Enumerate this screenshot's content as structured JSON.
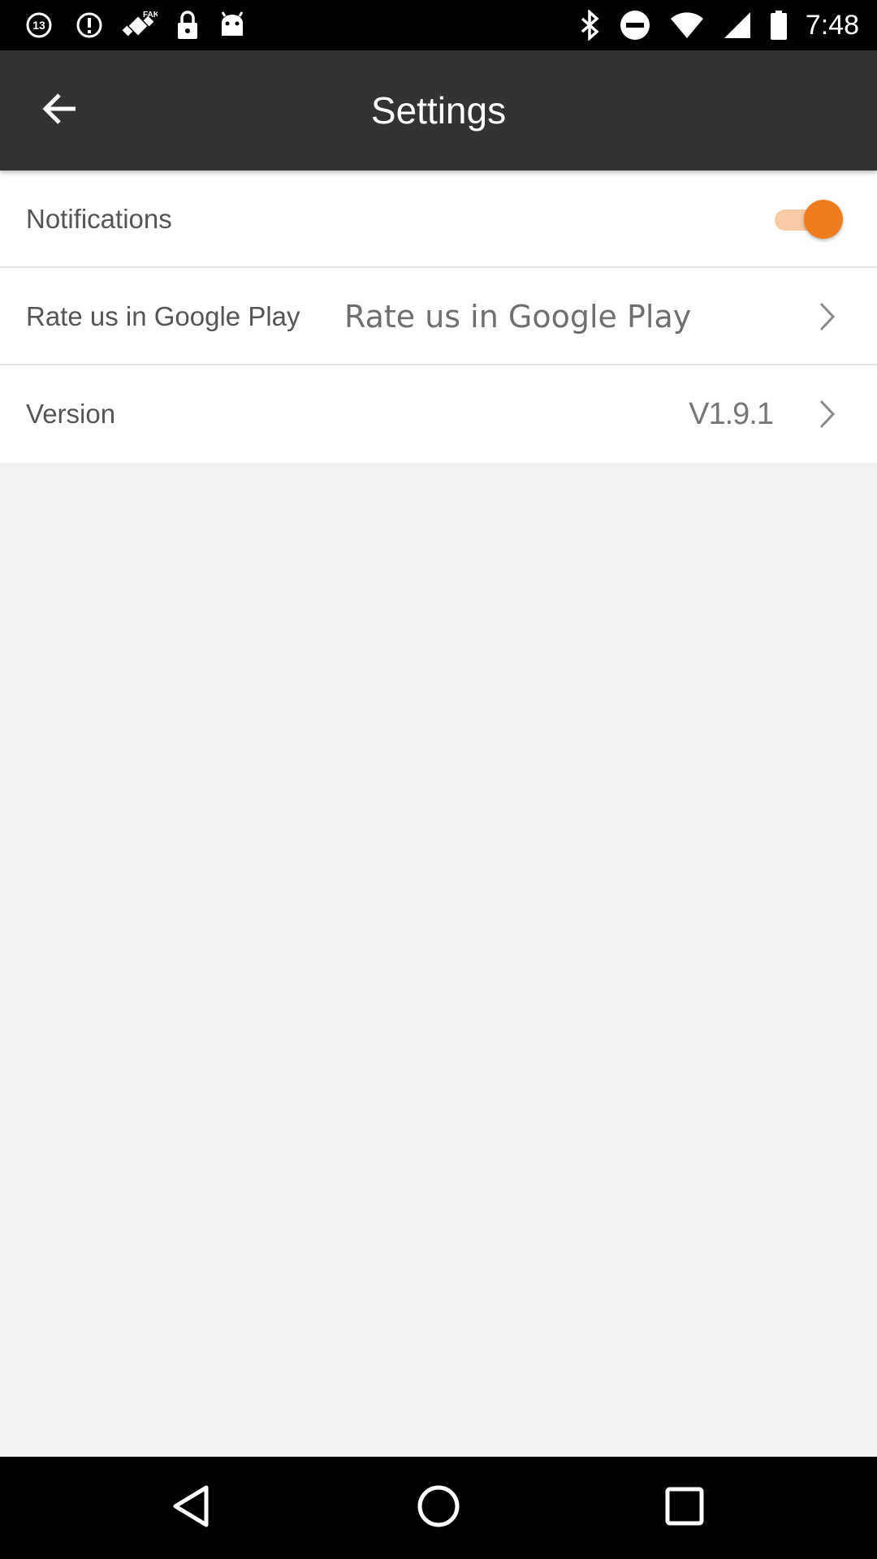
{
  "status_bar": {
    "time": "7:48",
    "left_icons": [
      "abc13-news-icon",
      "fake-gps-icon",
      "alert-icon",
      "satellite-icon",
      "lock-icon",
      "android-icon"
    ],
    "right_icons": [
      "bluetooth-icon",
      "do-not-disturb-icon",
      "wifi-icon",
      "cell-signal-icon",
      "battery-icon"
    ],
    "left_badge_texts": {
      "news": "13",
      "fake": "FAKE"
    }
  },
  "app_bar": {
    "title": "Settings",
    "back_icon": "arrow-back-icon"
  },
  "settings": {
    "notifications": {
      "label": "Notifications",
      "enabled": true
    },
    "rate": {
      "label": "Rate us in Google Play",
      "value": "Rate us in Google Play"
    },
    "version": {
      "label": "Version",
      "value": "V1.9.1"
    }
  },
  "colors": {
    "accent": "#ef7d1e",
    "accent_light": "#f7c9a4",
    "app_bar": "#333333",
    "background": "#f2f2f2"
  },
  "nav_bar": {
    "icons": [
      "back-triangle-icon",
      "home-circle-icon",
      "recents-square-icon"
    ]
  }
}
